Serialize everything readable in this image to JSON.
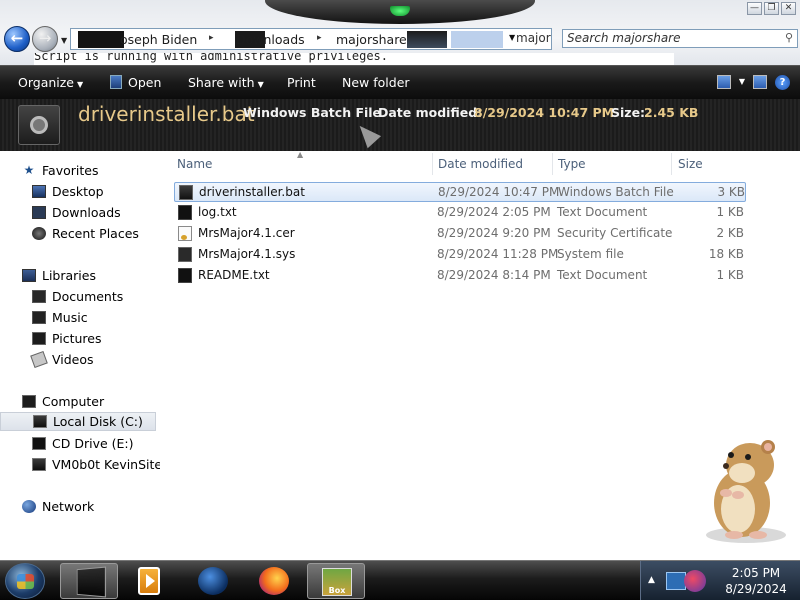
{
  "window": {
    "buttons": [
      "—",
      "❐",
      "✕"
    ]
  },
  "address": {
    "crumbs": [
      "oseph Biden",
      "Downloads",
      "majorshare"
    ],
    "right_fragment": "major",
    "search_placeholder": "Search majorshare"
  },
  "console_line": "Script is running with administrative privileges.",
  "toolbar": {
    "organize": "Organize",
    "open": "Open",
    "share_with": "Share with",
    "print": "Print",
    "new_folder": "New folder"
  },
  "details": {
    "name": "driverinstaller.bat",
    "type": "Windows Batch File",
    "modified_label": "Date modified:",
    "modified_value": "8/29/2024 10:47 PM",
    "size_label": "Size:",
    "size_value": "2.45 KB"
  },
  "nav": {
    "favorites": "Favorites",
    "desktop": "Desktop",
    "downloads": "Downloads",
    "recent_places": "Recent Places",
    "libraries": "Libraries",
    "documents": "Documents",
    "music": "Music",
    "pictures": "Pictures",
    "videos": "Videos",
    "computer": "Computer",
    "local_disk": "Local Disk (C:)",
    "cd_drive": "CD Drive (E:)",
    "share": "VM0b0t KevinSite",
    "network": "Network"
  },
  "columns": {
    "name": "Name",
    "date": "Date modified",
    "type": "Type",
    "size": "Size"
  },
  "files": [
    {
      "name": "driverinstaller.bat",
      "date": "8/29/2024 10:47 PM",
      "type": "Windows Batch File",
      "size": "3 KB",
      "icon": "bat-icon"
    },
    {
      "name": "log.txt",
      "date": "8/29/2024 2:05 PM",
      "type": "Text Document",
      "size": "1 KB",
      "icon": "txt-icon"
    },
    {
      "name": "MrsMajor4.1.cer",
      "date": "8/29/2024 9:20 PM",
      "type": "Security Certificate",
      "size": "2 KB",
      "icon": "cer-icon"
    },
    {
      "name": "MrsMajor4.1.sys",
      "date": "8/29/2024 11:28 PM",
      "type": "System file",
      "size": "18 KB",
      "icon": "sys-icon"
    },
    {
      "name": "README.txt",
      "date": "8/29/2024 8:14 PM",
      "type": "Text Document",
      "size": "1 KB",
      "icon": "txt-icon"
    }
  ],
  "taskbar": {
    "game_label": "Box",
    "clock_time": "2:05 PM",
    "clock_date": "8/29/2024"
  }
}
